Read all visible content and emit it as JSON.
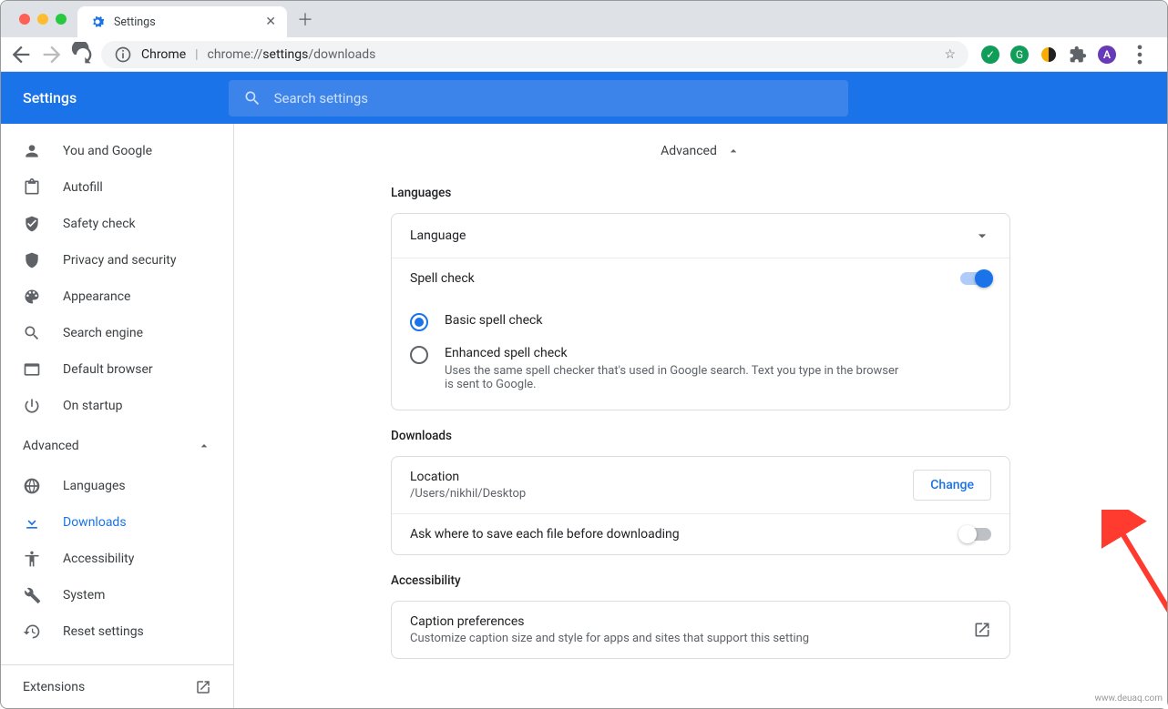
{
  "browser": {
    "tab_title": "Settings",
    "url_label_chrome": "Chrome",
    "url_path_prefix": "chrome://",
    "url_path_main": "settings",
    "url_path_sub": "/downloads"
  },
  "header": {
    "title": "Settings",
    "search_placeholder": "Search settings"
  },
  "sidebar": {
    "items": [
      {
        "label": "You and Google"
      },
      {
        "label": "Autofill"
      },
      {
        "label": "Safety check"
      },
      {
        "label": "Privacy and security"
      },
      {
        "label": "Appearance"
      },
      {
        "label": "Search engine"
      },
      {
        "label": "Default browser"
      },
      {
        "label": "On startup"
      }
    ],
    "advanced_label": "Advanced",
    "advanced_items": [
      {
        "label": "Languages"
      },
      {
        "label": "Downloads"
      },
      {
        "label": "Accessibility"
      },
      {
        "label": "System"
      },
      {
        "label": "Reset settings"
      }
    ],
    "extensions_label": "Extensions"
  },
  "main": {
    "advanced_divider": "Advanced",
    "languages": {
      "title": "Languages",
      "language_row": "Language",
      "spellcheck_row": "Spell check",
      "basic_label": "Basic spell check",
      "enhanced_label": "Enhanced spell check",
      "enhanced_desc": "Uses the same spell checker that's used in Google search. Text you type in the browser is sent to Google."
    },
    "downloads": {
      "title": "Downloads",
      "location_label": "Location",
      "location_value": "/Users/nikhil/Desktop",
      "change_btn": "Change",
      "ask_label": "Ask where to save each file before downloading"
    },
    "accessibility": {
      "title": "Accessibility",
      "caption_label": "Caption preferences",
      "caption_desc": "Customize caption size and style for apps and sites that support this setting"
    }
  },
  "watermark": "www.deuaq.com"
}
